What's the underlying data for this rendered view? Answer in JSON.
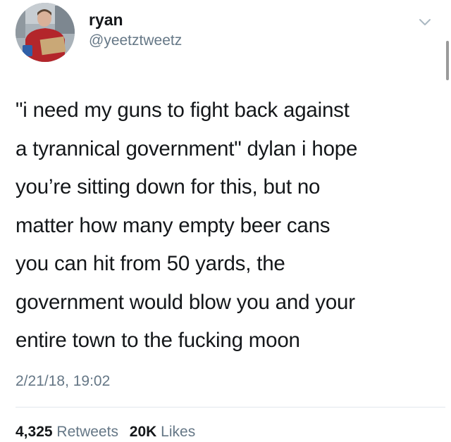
{
  "user": {
    "display_name": "ryan",
    "handle": "@yeetztweetz"
  },
  "tweet": {
    "lines": [
      "\"i need my guns to fight back against",
      "a tyrannical government\" dylan i hope",
      "you’re sitting down for this, but no",
      "matter how many empty beer cans",
      "you can hit from 50 yards, the",
      "government would blow you and your",
      "entire town to the fucking moon"
    ],
    "timestamp": "2/21/18, 19:02"
  },
  "stats": {
    "retweets_count": "4,325",
    "retweets_label": "Retweets",
    "likes_count": "20K",
    "likes_label": "Likes"
  },
  "icons": {
    "menu": "chevron-down-icon"
  },
  "colors": {
    "text": "#14171a",
    "secondary": "#657786",
    "divider": "#e1e8ed"
  }
}
